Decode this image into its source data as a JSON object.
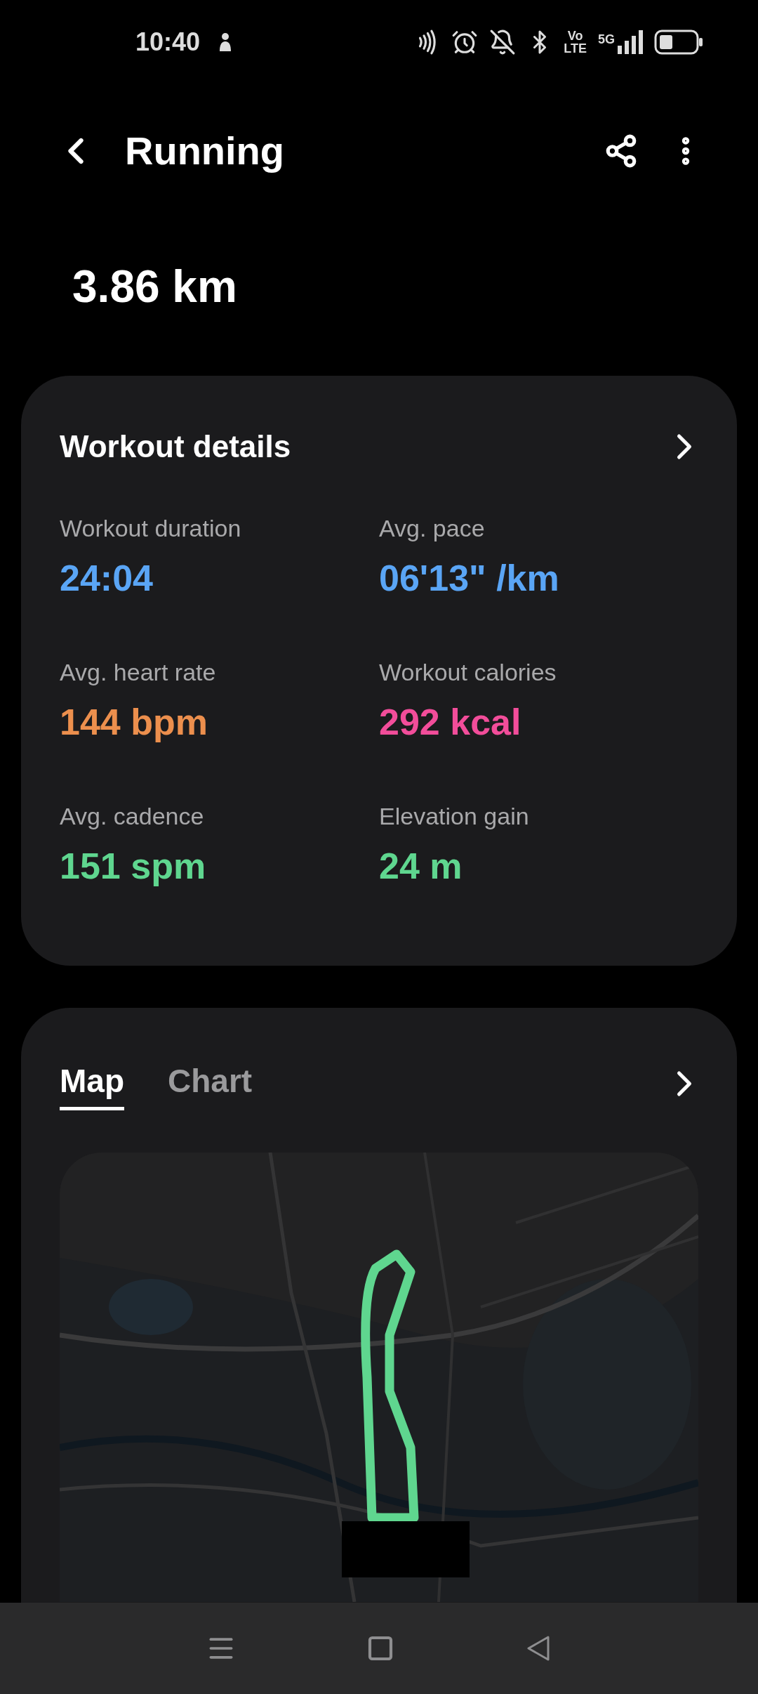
{
  "status_bar": {
    "time": "10:40",
    "volte_top": "Vo",
    "volte_bottom": "LTE",
    "network": "5G"
  },
  "header": {
    "title": "Running"
  },
  "distance": "3.86 km",
  "workout_details": {
    "title": "Workout details",
    "stats": [
      {
        "label": "Workout duration",
        "value": "24:04",
        "color": "#5aa5f5"
      },
      {
        "label": "Avg. pace",
        "value": "06'13\" /km",
        "color": "#5aa5f5"
      },
      {
        "label": "Avg. heart rate",
        "value": "144 bpm",
        "color": "#ec8f4d"
      },
      {
        "label": "Workout calories",
        "value": "292 kcal",
        "color": "#f24d9a"
      },
      {
        "label": "Avg. cadence",
        "value": "151 spm",
        "color": "#5fd68f"
      },
      {
        "label": "Elevation gain",
        "value": "24 m",
        "color": "#5fd68f"
      }
    ]
  },
  "route_card": {
    "tabs": [
      {
        "label": "Map",
        "selected": true
      },
      {
        "label": "Chart",
        "selected": false
      }
    ]
  }
}
